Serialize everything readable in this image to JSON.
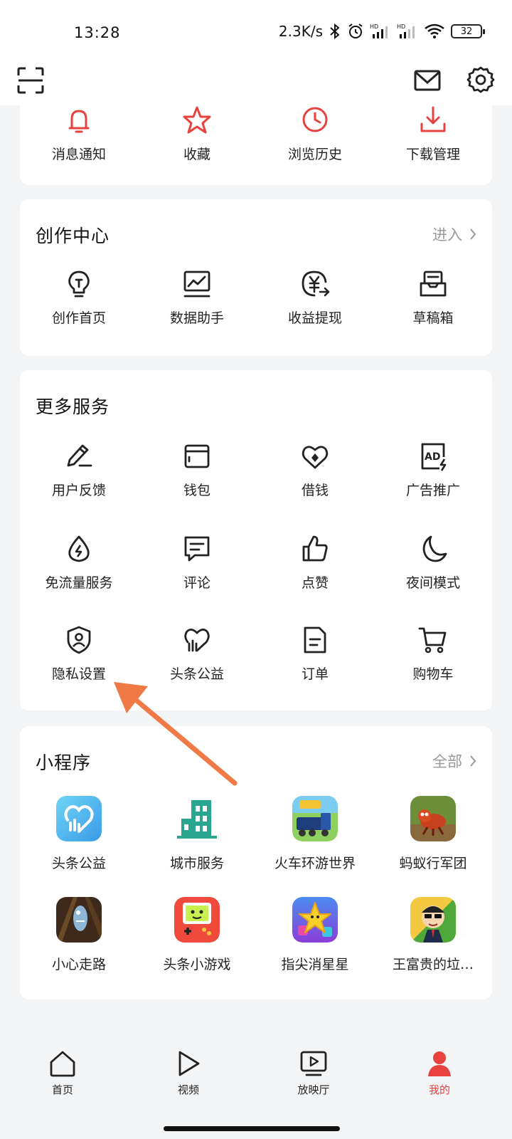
{
  "status_bar": {
    "time": "13:28",
    "speed": "2.3K/s",
    "battery": "32",
    "icons": [
      "bluetooth-icon",
      "alarm-icon",
      "hd-signal-icon",
      "hd-signal-icon",
      "wifi-icon",
      "battery-icon"
    ]
  },
  "top_bar": {
    "icons": [
      "scan-icon",
      "mail-icon",
      "settings-icon"
    ]
  },
  "quick_row": {
    "items": [
      {
        "label": "消息通知",
        "icon": "bell-icon"
      },
      {
        "label": "收藏",
        "icon": "star-icon"
      },
      {
        "label": "浏览历史",
        "icon": "clock-icon"
      },
      {
        "label": "下载管理",
        "icon": "download-icon"
      }
    ],
    "accent": "#e8423f"
  },
  "creation_center": {
    "title": "创作中心",
    "link": "进入",
    "items": [
      {
        "label": "创作首页",
        "icon": "lightbulb-icon"
      },
      {
        "label": "数据助手",
        "icon": "chart-monitor-icon"
      },
      {
        "label": "收益提现",
        "icon": "yuan-icon"
      },
      {
        "label": "草稿箱",
        "icon": "draft-box-icon"
      }
    ]
  },
  "more_services": {
    "title": "更多服务",
    "items": [
      {
        "label": "用户反馈",
        "icon": "pencil-icon"
      },
      {
        "label": "钱包",
        "icon": "wallet-icon"
      },
      {
        "label": "借钱",
        "icon": "loan-icon"
      },
      {
        "label": "广告推广",
        "icon": "ad-icon"
      },
      {
        "label": "免流量服务",
        "icon": "data-drop-icon"
      },
      {
        "label": "评论",
        "icon": "comment-icon"
      },
      {
        "label": "点赞",
        "icon": "thumbs-up-icon"
      },
      {
        "label": "夜间模式",
        "icon": "moon-icon"
      },
      {
        "label": "隐私设置",
        "icon": "privacy-shield-icon"
      },
      {
        "label": "头条公益",
        "icon": "charity-heart-icon"
      },
      {
        "label": "订单",
        "icon": "order-icon"
      },
      {
        "label": "购物车",
        "icon": "cart-icon"
      }
    ]
  },
  "mini_programs": {
    "title": "小程序",
    "link": "全部",
    "items": [
      {
        "label": "头条公益",
        "icon": "charity-app-icon"
      },
      {
        "label": "城市服务",
        "icon": "city-service-app-icon"
      },
      {
        "label": "火车环游世界",
        "icon": "train-game-icon"
      },
      {
        "label": "蚂蚁行军团",
        "icon": "ant-game-icon"
      },
      {
        "label": "小心走路",
        "icon": "shark-game-icon"
      },
      {
        "label": "头条小游戏",
        "icon": "gameboy-app-icon"
      },
      {
        "label": "指尖消星星",
        "icon": "star-game-icon"
      },
      {
        "label": "王富贵的垃…",
        "icon": "wang-fugui-game-icon"
      }
    ]
  },
  "bottom_nav": {
    "items": [
      {
        "label": "首页",
        "icon": "home-icon"
      },
      {
        "label": "视频",
        "icon": "play-icon"
      },
      {
        "label": "放映厅",
        "icon": "screening-room-icon"
      },
      {
        "label": "我的",
        "icon": "profile-icon"
      }
    ],
    "active_color": "#e8423f"
  }
}
